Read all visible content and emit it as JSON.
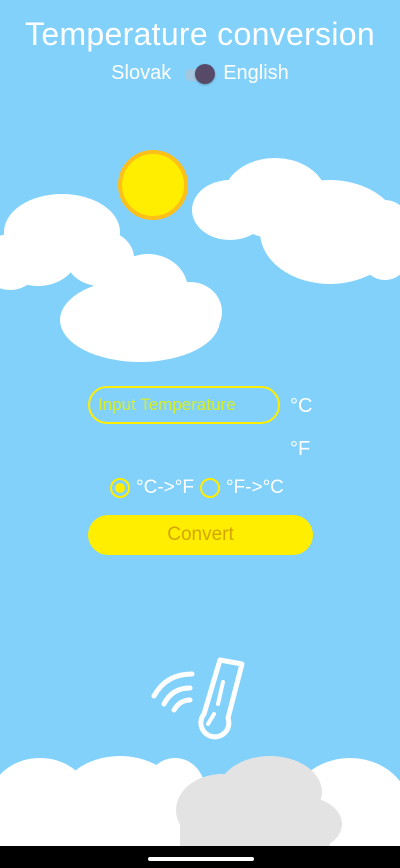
{
  "header": {
    "title": "Temperature conversion",
    "lang_left": "Slovak",
    "lang_right": "English"
  },
  "form": {
    "input_placeholder": "Input Temperature",
    "input_value": "",
    "unit_top": "°C",
    "unit_bottom": "°F",
    "option_c_to_f": "°C->°F",
    "option_f_to_c": "°F->°C",
    "selected_option": "°C->°F",
    "convert_label": "Convert"
  },
  "colors": {
    "background": "#82d1fb",
    "accent": "#ffee00",
    "button_text": "#d4a500",
    "sun_border": "#fdc01a"
  },
  "icons": [
    "sun-icon",
    "cloud-icon",
    "thermometer-icon"
  ]
}
